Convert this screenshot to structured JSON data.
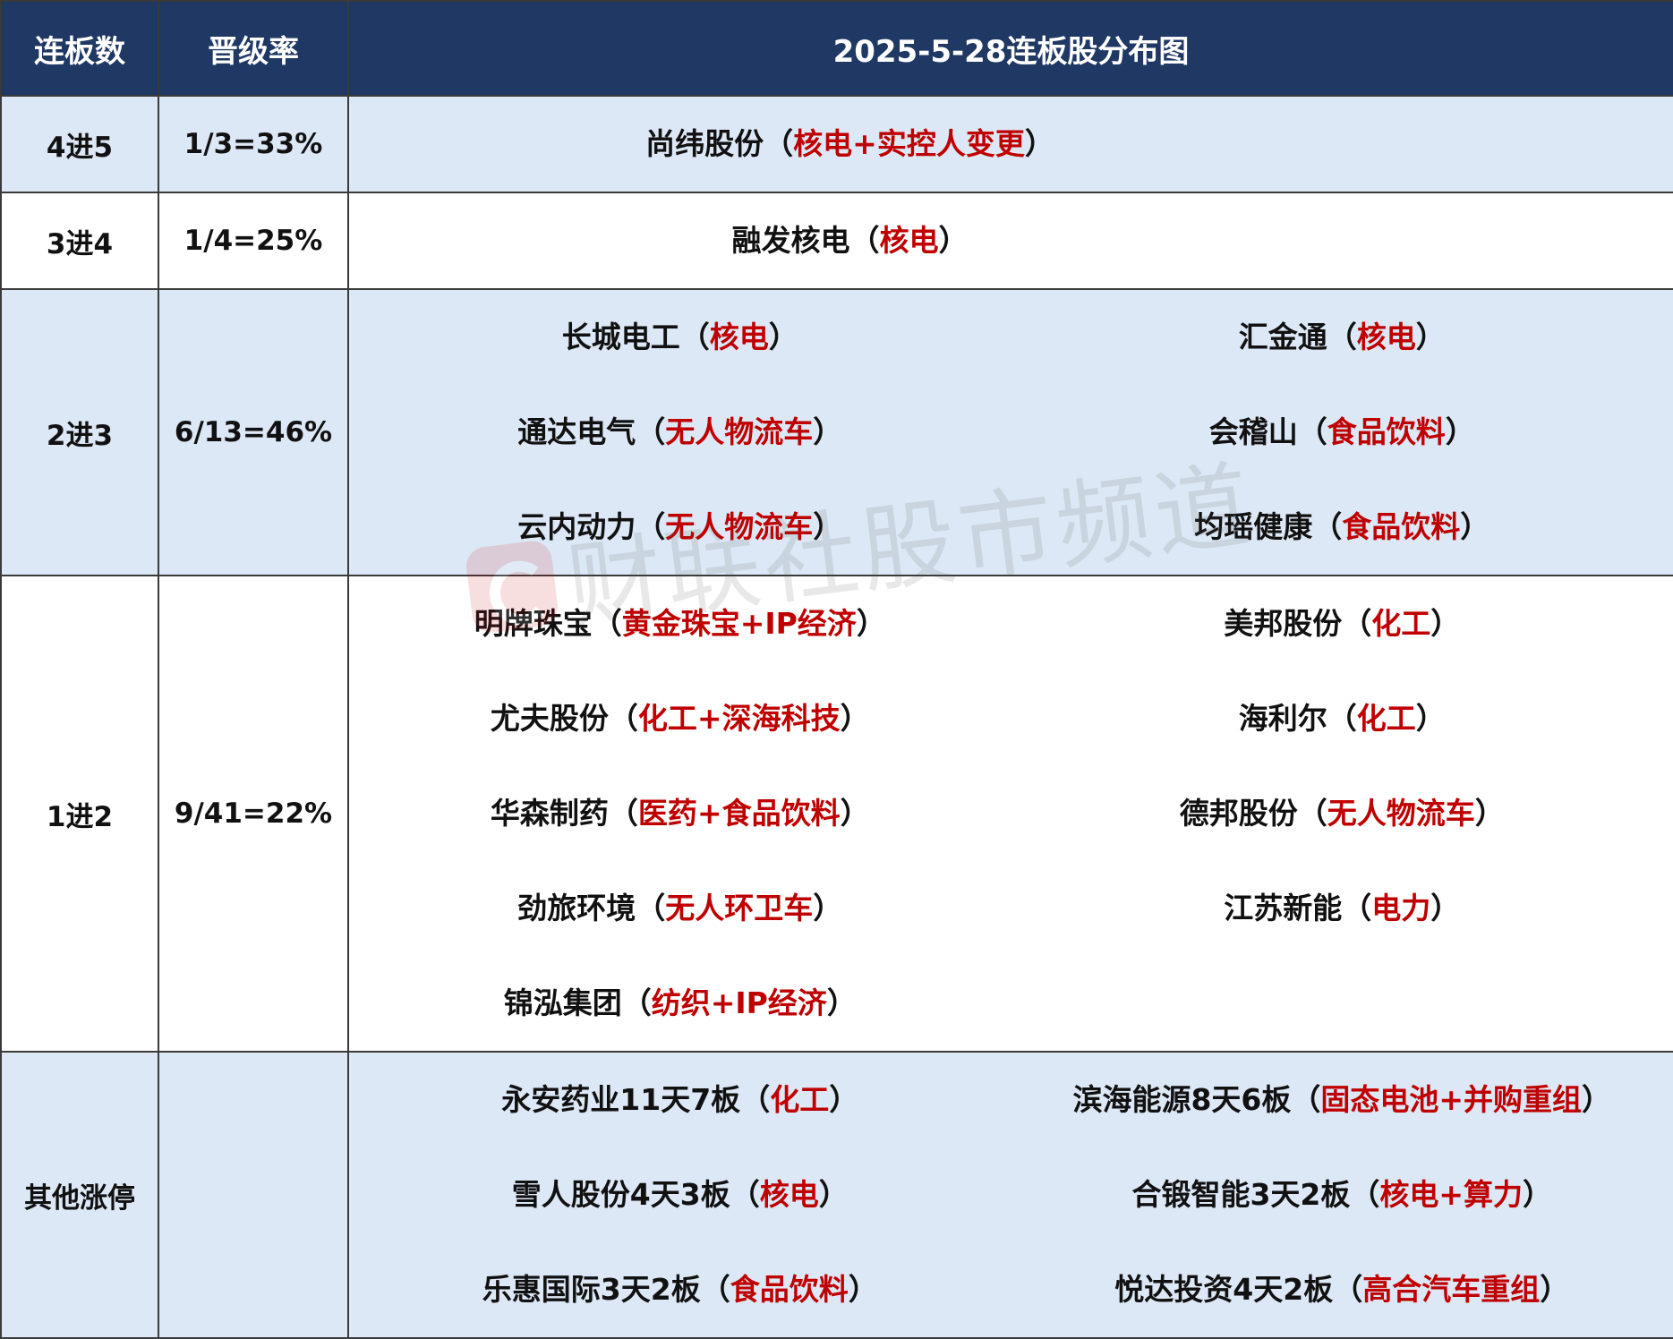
{
  "header": {
    "col_levels": "连板数",
    "col_rate": "晋级率",
    "col_title": "2025-5-28连板股分布图"
  },
  "rows": [
    {
      "level": "4进5",
      "rate": "1/3=33%",
      "stocks": [
        {
          "name": "尚纬股份",
          "tag": "核电+实控人变更"
        }
      ]
    },
    {
      "level": "3进4",
      "rate": "1/4=25%",
      "stocks": [
        {
          "name": "融发核电",
          "tag": "核电"
        }
      ]
    },
    {
      "level": "2进3",
      "rate": "6/13=46%",
      "stocks": [
        {
          "name": "长城电工",
          "tag": "核电"
        },
        {
          "name": "汇金通",
          "tag": "核电"
        },
        {
          "name": "通达电气",
          "tag": "无人物流车"
        },
        {
          "name": "会稽山",
          "tag": "食品饮料"
        },
        {
          "name": "云内动力",
          "tag": "无人物流车"
        },
        {
          "name": "均瑶健康",
          "tag": "食品饮料"
        }
      ]
    },
    {
      "level": "1进2",
      "rate": "9/41=22%",
      "stocks": [
        {
          "name": "明牌珠宝",
          "tag": "黄金珠宝+IP经济"
        },
        {
          "name": "美邦股份",
          "tag": "化工"
        },
        {
          "name": "尤夫股份",
          "tag": "化工+深海科技"
        },
        {
          "name": "海利尔",
          "tag": "化工"
        },
        {
          "name": "华森制药",
          "tag": "医药+食品饮料"
        },
        {
          "name": "德邦股份",
          "tag": "无人物流车"
        },
        {
          "name": "劲旅环境",
          "tag": "无人环卫车"
        },
        {
          "name": "江苏新能",
          "tag": "电力"
        },
        {
          "name": "锦泓集团",
          "tag": "纺织+IP经济"
        }
      ]
    },
    {
      "level": "其他涨停",
      "rate": "",
      "stocks": [
        {
          "name": "永安药业11天7板",
          "tag": "化工"
        },
        {
          "name": "滨海能源8天6板",
          "tag": "固态电池+并购重组"
        },
        {
          "name": "雪人股份4天3板",
          "tag": "核电"
        },
        {
          "name": "合锻智能3天2板",
          "tag": "核电+算力"
        },
        {
          "name": "乐惠国际3天2板",
          "tag": "食品饮料"
        },
        {
          "name": "悦达投资4天2板",
          "tag": "高合汽车重组"
        }
      ]
    }
  ],
  "watermark": "财联社股市频道",
  "colors": {
    "header_bg": "#1f3864",
    "row_blue": "#dce8f5",
    "tag_red": "#c00000"
  }
}
